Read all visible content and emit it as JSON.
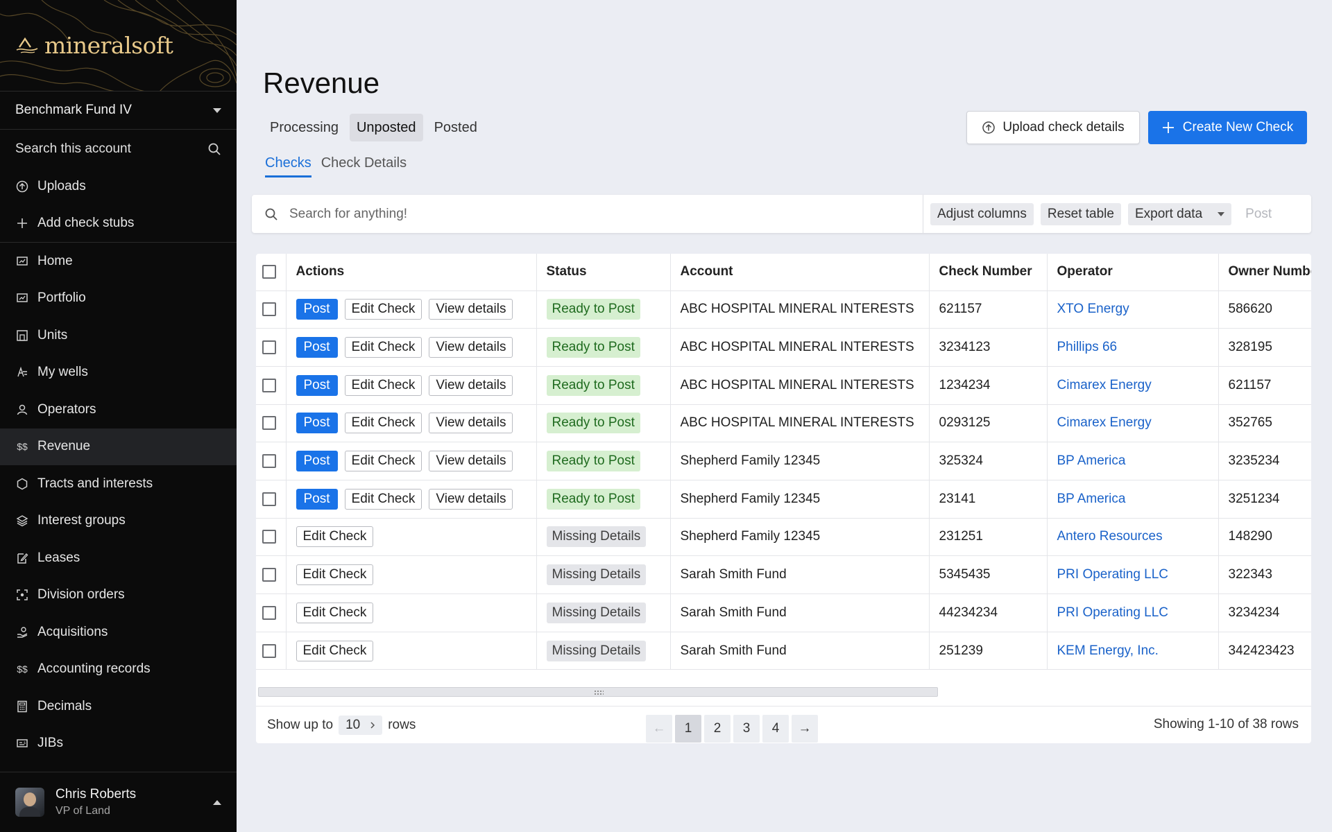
{
  "brand": {
    "name": "mineralsoft"
  },
  "sidebar": {
    "fund": "Benchmark Fund IV",
    "search_label": "Search this account",
    "top_items": [
      {
        "label": "Uploads",
        "icon": "upload-icon"
      },
      {
        "label": "Add check stubs",
        "icon": "plus-icon"
      }
    ],
    "items": [
      {
        "label": "Home",
        "icon": "home-icon"
      },
      {
        "label": "Portfolio",
        "icon": "portfolio-icon"
      },
      {
        "label": "Units",
        "icon": "units-icon"
      },
      {
        "label": "My wells",
        "icon": "wells-icon"
      },
      {
        "label": "Operators",
        "icon": "operators-icon"
      },
      {
        "label": "Revenue",
        "icon": "revenue-icon",
        "active": true
      },
      {
        "label": "Tracts and interests",
        "icon": "tracts-icon"
      },
      {
        "label": "Interest groups",
        "icon": "layers-icon"
      },
      {
        "label": "Leases",
        "icon": "lease-icon"
      },
      {
        "label": "Division orders",
        "icon": "division-icon"
      },
      {
        "label": "Acquisitions",
        "icon": "acquisitions-icon"
      },
      {
        "label": "Accounting records",
        "icon": "accounting-icon"
      },
      {
        "label": "Decimals",
        "icon": "calculator-icon"
      },
      {
        "label": "JIBs",
        "icon": "jibs-icon"
      }
    ],
    "user": {
      "name": "Chris Roberts",
      "role": "VP of Land"
    }
  },
  "page": {
    "title": "Revenue",
    "tabs": [
      {
        "label": "Processing",
        "active": false
      },
      {
        "label": "Unposted",
        "active": true
      },
      {
        "label": "Posted",
        "active": false
      }
    ],
    "subtabs": [
      {
        "label": "Checks",
        "active": true
      },
      {
        "label": "Check Details",
        "active": false
      }
    ],
    "upload_label": "Upload check details",
    "create_label": "Create New Check"
  },
  "toolbar": {
    "search_placeholder": "Search for anything!",
    "adjust_label": "Adjust columns",
    "reset_label": "Reset table",
    "export_label": "Export data",
    "post_label": "Post"
  },
  "table": {
    "columns": [
      "Actions",
      "Status",
      "Account",
      "Check Number",
      "Operator",
      "Owner Number"
    ],
    "action_labels": {
      "post": "Post",
      "edit": "Edit Check",
      "view": "View details"
    },
    "rows": [
      {
        "ready": true,
        "status": "Ready to Post",
        "account": "ABC HOSPITAL MINERAL INTERESTS",
        "check": "621157",
        "operator": "XTO Energy",
        "owner": "586620"
      },
      {
        "ready": true,
        "status": "Ready to Post",
        "account": "ABC HOSPITAL MINERAL INTERESTS",
        "check": "3234123",
        "operator": "Phillips 66",
        "owner": "328195"
      },
      {
        "ready": true,
        "status": "Ready to Post",
        "account": "ABC HOSPITAL MINERAL INTERESTS",
        "check": "1234234",
        "operator": "Cimarex Energy",
        "owner": "621157"
      },
      {
        "ready": true,
        "status": "Ready to Post",
        "account": "ABC HOSPITAL MINERAL INTERESTS",
        "check": "0293125",
        "operator": "Cimarex Energy",
        "owner": "352765"
      },
      {
        "ready": true,
        "status": "Ready to Post",
        "account": "Shepherd Family 12345",
        "check": "325324",
        "operator": "BP America",
        "owner": "3235234"
      },
      {
        "ready": true,
        "status": "Ready to Post",
        "account": "Shepherd Family 12345",
        "check": "23141",
        "operator": "BP America",
        "owner": "3251234"
      },
      {
        "ready": false,
        "status": "Missing Details",
        "account": "Shepherd Family 12345",
        "check": "231251",
        "operator": "Antero Resources",
        "owner": "148290"
      },
      {
        "ready": false,
        "status": "Missing Details",
        "account": "Sarah Smith Fund",
        "check": "5345435",
        "operator": "PRI Operating LLC",
        "owner": "322343"
      },
      {
        "ready": false,
        "status": "Missing Details",
        "account": "Sarah Smith Fund",
        "check": "44234234",
        "operator": "PRI Operating LLC",
        "owner": "3234234"
      },
      {
        "ready": false,
        "status": "Missing Details",
        "account": "Sarah Smith Fund",
        "check": "251239",
        "operator": "KEM Energy, Inc.",
        "owner": "342423423"
      }
    ]
  },
  "pagination": {
    "show_label": "Show up to",
    "rows_value": "10",
    "rows_label": "rows",
    "prev": "←",
    "next": "→",
    "pages": [
      "1",
      "2",
      "3",
      "4"
    ],
    "current": "1",
    "summary": "Showing 1-10 of 38 rows"
  },
  "colors": {
    "accent": "#1a73e8",
    "ready_bg": "#d6efd0",
    "sidebar_bg": "#0b0b0b",
    "brand_gold": "#e8c98a"
  }
}
